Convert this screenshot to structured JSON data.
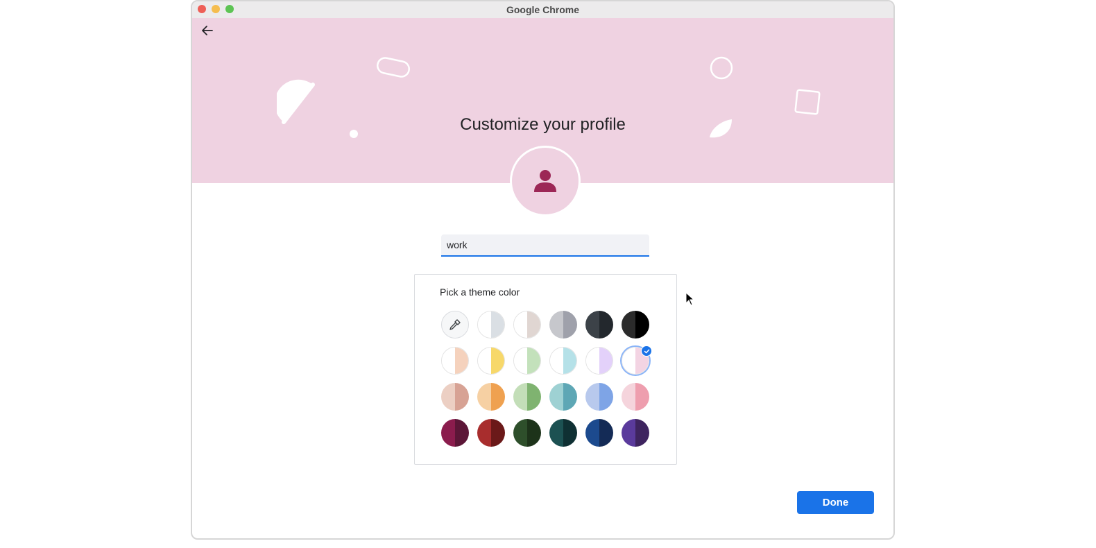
{
  "window": {
    "title": "Google Chrome"
  },
  "page": {
    "title": "Customize your profile"
  },
  "profile": {
    "name_value": "work"
  },
  "theme": {
    "title": "Pick a theme color",
    "selected_index": 11,
    "swatches": [
      {
        "left": "#e3e6ea",
        "right": "#e3e6ea",
        "kind": "picker"
      },
      {
        "left": "#ffffff",
        "right": "#dadfe4"
      },
      {
        "left": "#ffffff",
        "right": "#e0d6d2"
      },
      {
        "left": "#c6c7cc",
        "right": "#9fa1ab"
      },
      {
        "left": "#3c4248",
        "right": "#23282d"
      },
      {
        "left": "#2b2b2b",
        "right": "#000000"
      },
      {
        "left": "#ffffff",
        "right": "#f5d2bd"
      },
      {
        "left": "#ffffff",
        "right": "#f7d86a"
      },
      {
        "left": "#ffffff",
        "right": "#c3e1bb"
      },
      {
        "left": "#ffffff",
        "right": "#b5e1e8"
      },
      {
        "left": "#ffffff",
        "right": "#e3d1fa"
      },
      {
        "left": "#ffffff",
        "right": "#f3d4e3"
      },
      {
        "left": "#eccfc3",
        "right": "#d7a294"
      },
      {
        "left": "#f6d0a3",
        "right": "#efa150"
      },
      {
        "left": "#c3deb8",
        "right": "#7fb370"
      },
      {
        "left": "#9ed1d3",
        "right": "#5ea7b5"
      },
      {
        "left": "#b8c9ed",
        "right": "#7ea4e6"
      },
      {
        "left": "#f5d4dc",
        "right": "#ee9eae"
      },
      {
        "left": "#8b1c4d",
        "right": "#5c1637"
      },
      {
        "left": "#a82d2d",
        "right": "#6b1919"
      },
      {
        "left": "#2e4f2b",
        "right": "#1d331a"
      },
      {
        "left": "#1c5152",
        "right": "#0f3033"
      },
      {
        "left": "#1c4a8e",
        "right": "#142b56"
      },
      {
        "left": "#5a3a9c",
        "right": "#3e245f"
      }
    ]
  },
  "actions": {
    "done_label": "Done"
  },
  "colors": {
    "banner": "#efd2e1",
    "accent": "#1a73e8",
    "avatar_person": "#9c2756"
  },
  "icons": {
    "back": "arrow-left-icon",
    "picker": "eyedropper-icon",
    "avatar": "person-icon",
    "check": "check-icon"
  }
}
